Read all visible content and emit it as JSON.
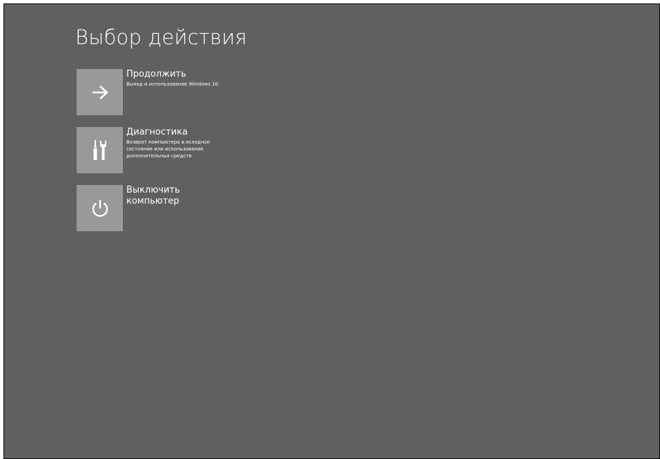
{
  "screen": {
    "title": "Выбор действия",
    "background_color": "#606060",
    "tile_color": "#999999"
  },
  "options": [
    {
      "label": "Продолжить",
      "description": "Выход и использование Windows 10",
      "icon": "arrow-right-icon"
    },
    {
      "label": "Диагностика",
      "description": "Возврат компьютера в исходное состояние или использование дополнительных средств",
      "icon": "tools-icon"
    },
    {
      "label": "Выключить компьютер",
      "description": "",
      "icon": "power-icon"
    }
  ]
}
